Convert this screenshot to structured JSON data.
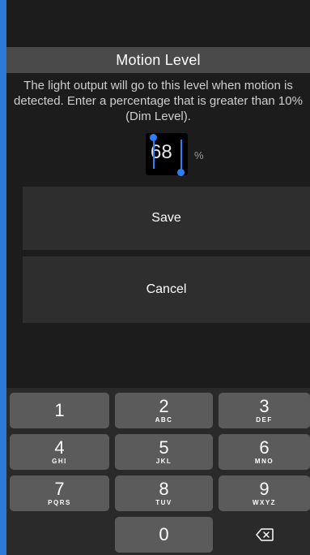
{
  "screen": {
    "title": "Motion Level",
    "description": "The light output will go to this level when motion is detected. Enter a percentage that is greater than 10% (Dim Level)."
  },
  "level_input": {
    "value": "68",
    "unit": "%"
  },
  "buttons": {
    "save_label": "Save",
    "cancel_label": "Cancel"
  },
  "keypad": {
    "keys": [
      {
        "digit": "1",
        "letters": ""
      },
      {
        "digit": "2",
        "letters": "ABC"
      },
      {
        "digit": "3",
        "letters": "DEF"
      },
      {
        "digit": "4",
        "letters": "GHI"
      },
      {
        "digit": "5",
        "letters": "JKL"
      },
      {
        "digit": "6",
        "letters": "MNO"
      },
      {
        "digit": "7",
        "letters": "PQRS"
      },
      {
        "digit": "8",
        "letters": "TUV"
      },
      {
        "digit": "9",
        "letters": "WXYZ"
      },
      {
        "digit": "0",
        "letters": ""
      }
    ],
    "delete_icon": "backspace-icon"
  },
  "colors": {
    "title_bar": "#4a4a4a",
    "button_bg": "#2e2e2e",
    "key_bg": "#5b5b5b",
    "selection": "#2d7ff9",
    "frame_accent": "#2b7bd6"
  }
}
